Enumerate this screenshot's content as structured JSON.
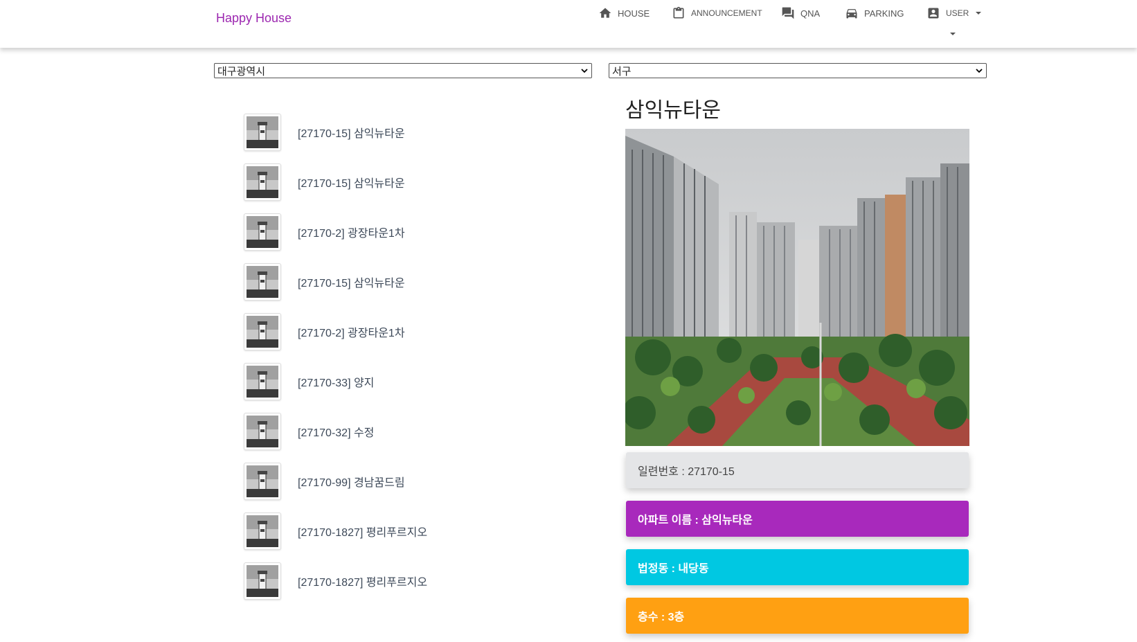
{
  "navbar": {
    "brand": "Happy House",
    "items": [
      {
        "label": "HOUSE",
        "icon": "home-icon"
      },
      {
        "label": "ANNOUNCEMENT",
        "icon": "clipboard-icon"
      },
      {
        "label": "QNA",
        "icon": "chat-icon"
      },
      {
        "label": "PARKING",
        "icon": "car-icon"
      },
      {
        "label": "USER",
        "icon": "account-box-icon"
      }
    ]
  },
  "filters": {
    "city": "대구광역시",
    "district": "서구"
  },
  "list": [
    {
      "label": "[27170-15] 삼익뉴타운"
    },
    {
      "label": "[27170-15] 삼익뉴타운"
    },
    {
      "label": "[27170-2] 광장타운1차"
    },
    {
      "label": "[27170-15] 삼익뉴타운"
    },
    {
      "label": "[27170-2] 광장타운1차"
    },
    {
      "label": "[27170-33] 양지"
    },
    {
      "label": "[27170-32] 수정"
    },
    {
      "label": "[27170-99] 경남꿈드림"
    },
    {
      "label": "[27170-1827] 평리푸르지오"
    },
    {
      "label": "[27170-1827] 평리푸르지오"
    }
  ],
  "detail": {
    "title": "삼익뉴타운",
    "serial": "일련번호 : 27170-15",
    "apt_name": "아파트 이름 : 삼익뉴타운",
    "dong": "법정동 : 내당동",
    "floor": "층수 : 3층"
  },
  "colors": {
    "brand": "#9c27b0",
    "purple": "#a829bc",
    "cyan": "#00c8e2",
    "orange": "#ffa012",
    "gray": "#e4e5e7"
  }
}
